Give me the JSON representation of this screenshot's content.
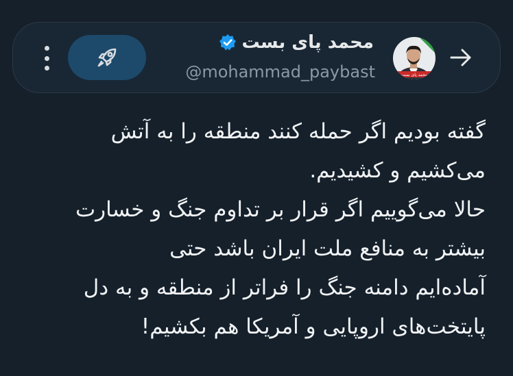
{
  "header": {
    "display_name": "محمد پای بست",
    "handle": "@mohammad_paybast",
    "avatar_badge_text": "محمد پای بست",
    "verified_icon": "verified-badge-icon",
    "back_icon": "arrow-right-icon",
    "boost_icon": "rocket-icon",
    "more_icon": "more-vertical-icon"
  },
  "tweet": {
    "lines": [
      "گفته بودیم اگر حمله کنند منطقه را به آتش",
      "می‌کشیم و کشیدیم.",
      "حالا می‌گوییم اگر قرار بر تداوم جنگ و خسارت",
      "بیشتر به منافع ملت ایران باشد حتی",
      "آماده‌ایم دامنه جنگ را فراتر از منطقه و به دل",
      "پایتخت‌های اروپایی و آمریکا هم بکشیم!"
    ]
  },
  "colors": {
    "background": "#15202b",
    "header_bg": "#192734",
    "boost_bg": "#1d4a6b",
    "verified": "#1d9bf0",
    "text": "#e7e9ea",
    "muted": "#8b98a5"
  }
}
